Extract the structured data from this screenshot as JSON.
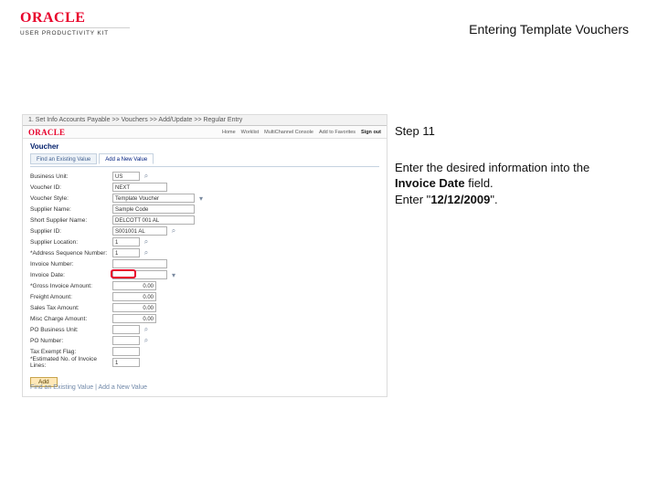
{
  "header": {
    "logo": "ORACLE",
    "subtitle": "USER PRODUCTIVITY KIT",
    "title": "Entering Template Vouchers"
  },
  "instruction": {
    "step": "Step 11",
    "line1a": "Enter the desired information into the ",
    "line1b": "Invoice Date",
    "line1c": " field.",
    "line2a": "Enter \"",
    "line2b": "12/12/2009",
    "line2c": "\"."
  },
  "shot": {
    "titlebar": "1. Set Info   Accounts Payable  >> Vouchers >> Add/Update >> Regular Entry",
    "nav_links": [
      "Home",
      "Worklist",
      "MultiChannel Console",
      "Add to Favorites",
      "Sign out"
    ],
    "heading": "Voucher",
    "tabs": [
      "Find an Existing Value",
      "Add a New Value"
    ],
    "fields": {
      "business_unit": {
        "label": "Business Unit:",
        "value": "US"
      },
      "voucher_id": {
        "label": "Voucher ID:",
        "value": "NEXT"
      },
      "voucher_style": {
        "label": "Voucher Style:",
        "value": "Template Voucher"
      },
      "supplier_name": {
        "label": "Supplier Name:",
        "value": "Sample Code"
      },
      "short_supplier_name": {
        "label": "Short Supplier Name:",
        "value": "DELCOTT 001 AL"
      },
      "supplier_id": {
        "label": "Supplier ID:",
        "value": "S001001 AL"
      },
      "supplier_location": {
        "label": "Supplier Location:",
        "value": "1"
      },
      "address_seq_num": {
        "label": "*Address Sequence Number:",
        "value": "1"
      },
      "invoice_number": {
        "label": "Invoice Number:",
        "value": ""
      },
      "invoice_date": {
        "label": "Invoice Date:",
        "value": ""
      },
      "gross_invoice_amount": {
        "label": "*Gross Invoice Amount:",
        "value": "0.00"
      },
      "freight_amount": {
        "label": "Freight Amount:",
        "value": "0.00"
      },
      "sales_tax_amount": {
        "label": "Sales Tax Amount:",
        "value": "0.00"
      },
      "misc_charge_amount": {
        "label": "Misc Charge Amount:",
        "value": "0.00"
      },
      "po_business_unit": {
        "label": "PO Business Unit:",
        "value": ""
      },
      "po_number": {
        "label": "PO Number:",
        "value": ""
      },
      "tax_exempt_flag": {
        "label": "Tax Exempt Flag:",
        "value": ""
      },
      "est_lines": {
        "label": "*Estimated No. of Invoice Lines:",
        "value": "1"
      }
    },
    "add_button": "Add",
    "footer": "Find an Existing Value | Add a New Value"
  }
}
